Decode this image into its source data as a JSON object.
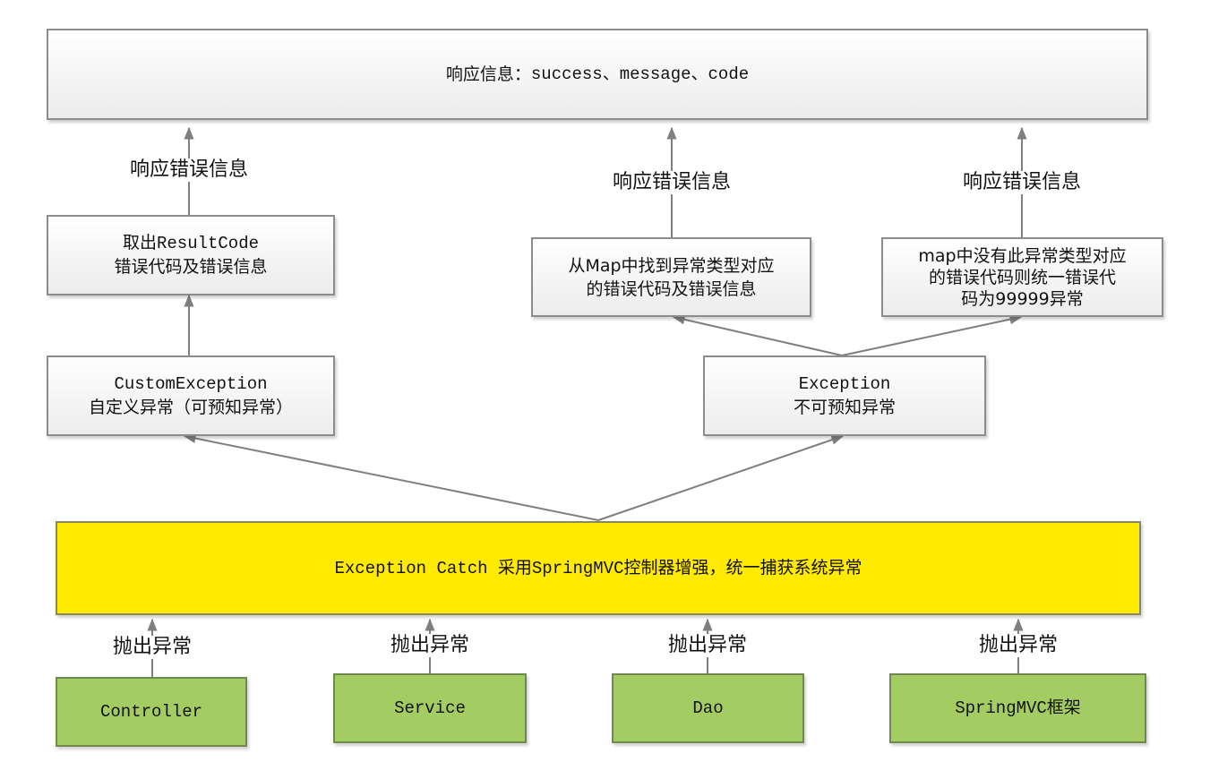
{
  "diagram": {
    "response_box": {
      "label_cn": "响应信息：",
      "label_en": "success、message、code"
    },
    "result_code_box": {
      "lines": [
        "取出ResultCode",
        "错误代码及错误信息"
      ]
    },
    "map_found_box": {
      "lines": [
        "从Map中找到异常类型对应",
        "的错误代码及错误信息"
      ]
    },
    "map_missing_box": {
      "lines": [
        "map中没有此异常类型对应",
        "的错误代码则统一错误代",
        "码为99999异常"
      ]
    },
    "custom_exception_box": {
      "lines": [
        "CustomException",
        "自定义异常（可预知异常）"
      ]
    },
    "exception_box": {
      "lines": [
        "Exception",
        "不可预知异常"
      ]
    },
    "catch_box": {
      "label": "Exception Catch 采用SpringMVC控制器增强，统一捕获系统异常"
    },
    "edge_labels": {
      "respond_error": "响应错误信息",
      "throw_exception": "抛出异常"
    },
    "sources": [
      {
        "label": "Controller"
      },
      {
        "label": "Service"
      },
      {
        "label": "Dao"
      },
      {
        "label": "SpringMVC框架"
      }
    ],
    "colors": {
      "gray_box": "#f2f2f2",
      "catch_box": "#ffea00",
      "source_box": "#a3cd63",
      "edge": "#7f7f7f"
    }
  }
}
